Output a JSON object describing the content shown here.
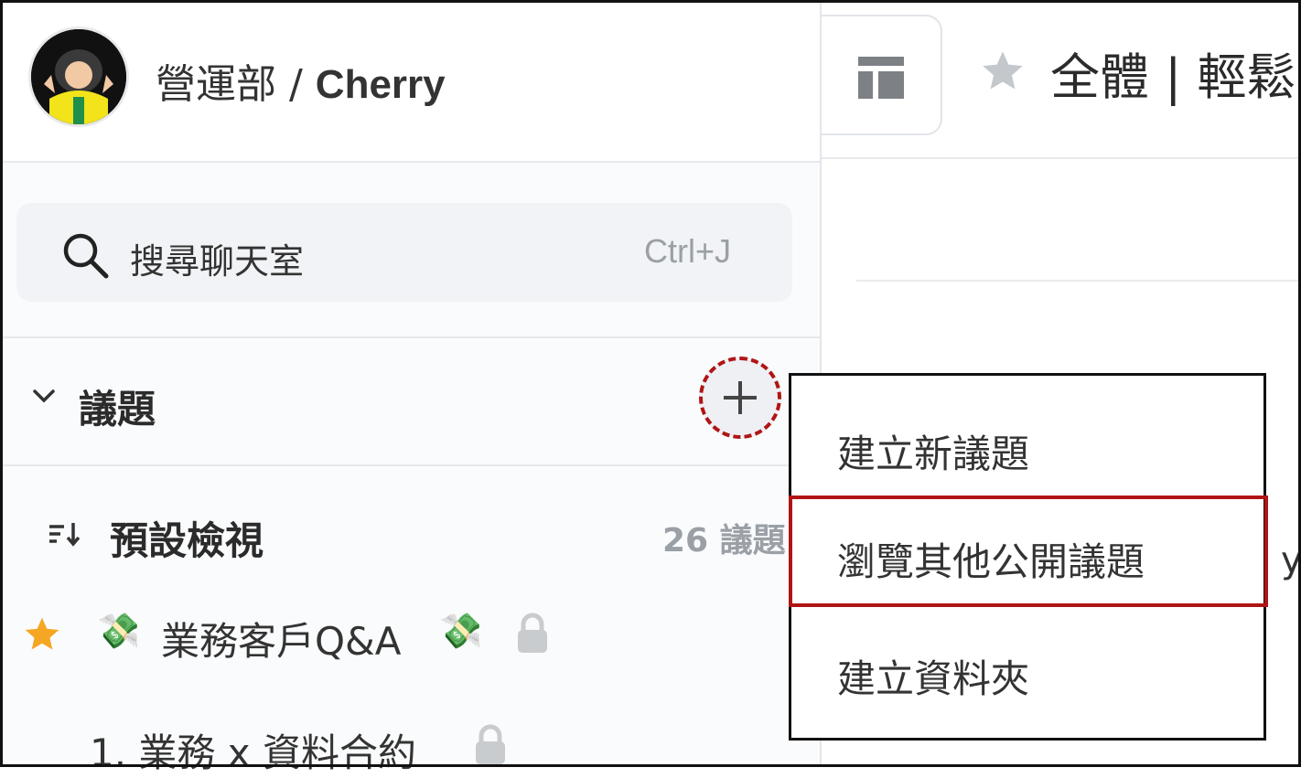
{
  "profile": {
    "department": "營運部",
    "separator": " / ",
    "user": "Cherry"
  },
  "search": {
    "placeholder": "搜尋聊天室",
    "shortcut": "Ctrl+J"
  },
  "section": {
    "title": "議題"
  },
  "default_view": {
    "title": "預設檢視",
    "count": "26 議題"
  },
  "topics": [
    {
      "label": "業務客戶Q&A"
    },
    {
      "label": "1. 業務 x 資料合約"
    }
  ],
  "header": {
    "title": "全體 | 輕鬆"
  },
  "right_partial": "y",
  "popup_menu": {
    "items": [
      {
        "label": "建立新議題"
      },
      {
        "label": "瀏覽其他公開議題"
      },
      {
        "label": "建立資料夾"
      }
    ]
  },
  "colors": {
    "highlight": "#b01515",
    "star": "#f5a623",
    "accent_gray": "#9aa0a6"
  }
}
